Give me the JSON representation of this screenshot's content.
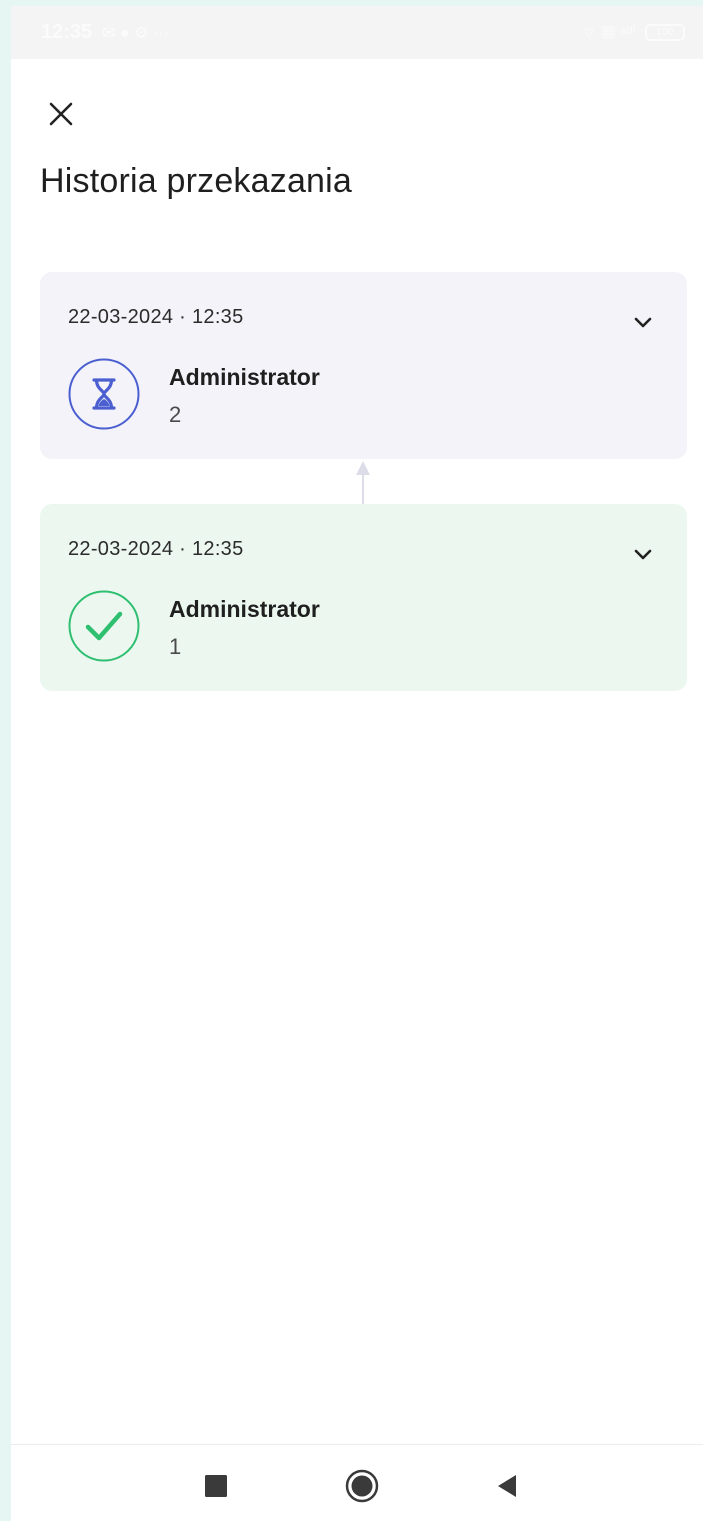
{
  "status_bar": {
    "time": "12:35",
    "left_glyphs": "✉ ● ⚙ ···",
    "signal_text": "⌔ ▦ ᵃᵗˡˡ",
    "battery_text": "100"
  },
  "header": {
    "title": "Historia przekazania"
  },
  "history": [
    {
      "datetime": "22-03-2024 · 12:35",
      "name": "Administrator",
      "number": "2",
      "status": "pending",
      "status_icon": "hourglass-icon",
      "accent": "#4b5fd1",
      "background": "#f3f3f9"
    },
    {
      "datetime": "22-03-2024 · 12:35",
      "name": "Administrator",
      "number": "1",
      "status": "completed",
      "status_icon": "check-icon",
      "accent": "#2fbf71",
      "background": "#ecf8ef"
    }
  ],
  "nav_bar": {
    "buttons": [
      "recents-icon",
      "home-icon",
      "back-icon"
    ]
  }
}
